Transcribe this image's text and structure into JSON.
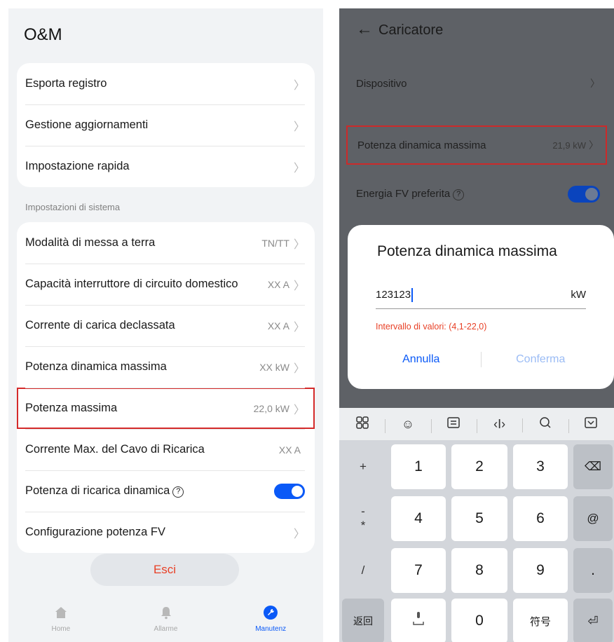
{
  "left": {
    "title": "O&M",
    "group1": [
      {
        "label": "Esporta registro"
      },
      {
        "label": "Gestione aggiornamenti"
      },
      {
        "label": "Impostazione rapida"
      }
    ],
    "section_title": "Impostazioni di sistema",
    "group2": [
      {
        "label": "Modalità di messa a terra",
        "value": "TN/TT"
      },
      {
        "label": "Capacità interruttore di circuito domestico",
        "value": "XX A"
      },
      {
        "label": "Corrente di carica declassata",
        "value": "XX A"
      },
      {
        "label": "Potenza dinamica massima",
        "value": "XX kW"
      },
      {
        "label": "Potenza massima",
        "value": "22,0 kW"
      },
      {
        "label": "Corrente Max. del Cavo di Ricarica",
        "value": "XX A"
      },
      {
        "label": "Potenza di ricarica dinamica",
        "help": "?",
        "toggle": true
      },
      {
        "label": "Configurazione potenza FV"
      }
    ],
    "exit_button": "Esci",
    "tabs": [
      {
        "label": "Home",
        "icon": "home-icon"
      },
      {
        "label": "Allarme",
        "icon": "bell-icon"
      },
      {
        "label": "Manutenz",
        "icon": "wrench-icon",
        "active": true
      }
    ],
    "accent_color": "#0a59f7",
    "danger_color": "#e84026"
  },
  "right": {
    "title": "Caricatore",
    "rows": [
      {
        "label": "Dispositivo"
      },
      {
        "label": "Potenza dinamica massima",
        "value": "21,9 kW"
      },
      {
        "label": "Energia FV preferita",
        "help": "?",
        "toggle": true
      }
    ],
    "dialog": {
      "title": "Potenza dinamica massima",
      "input_value": "123123",
      "unit": "kW",
      "range_text": "Intervallo di valori: (4,1-22,0)",
      "cancel": "Annulla",
      "confirm": "Conferma"
    },
    "keyboard": {
      "toolbar": [
        "grid-icon",
        "emoji-icon",
        "clipboard-icon",
        "cursor-icon",
        "search-icon",
        "hide-keyboard-icon"
      ],
      "digits": [
        "1",
        "2",
        "3",
        "4",
        "5",
        "6",
        "7",
        "8",
        "9",
        "0"
      ],
      "left_keys": [
        "+",
        "-",
        "*",
        "/"
      ],
      "right_keys": [
        "⌫",
        "@",
        "."
      ],
      "bottom": {
        "back": "返回",
        "symbols": "符号"
      }
    }
  }
}
